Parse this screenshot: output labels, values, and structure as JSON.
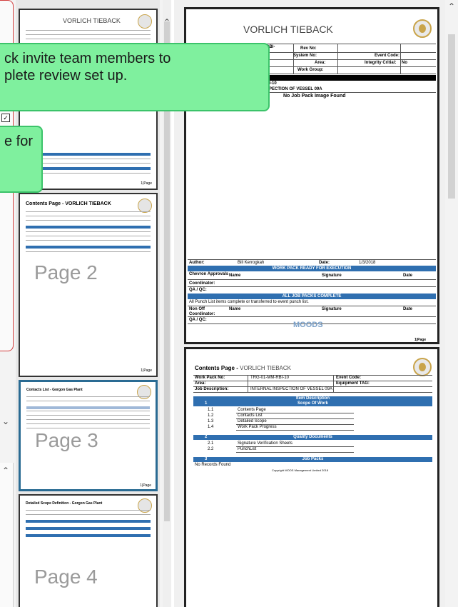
{
  "sidebar": {
    "scroll_up_icon": "chevron-up-icon",
    "scroll_down_icon": "chevron-down-icon"
  },
  "thumbnails": [
    {
      "id": "page-1",
      "title": "VORLICH TIEBACK",
      "label": ""
    },
    {
      "id": "page-2",
      "title": "Contents Page - VORLICH TIEBACK",
      "label": "Page 2"
    },
    {
      "id": "page-3",
      "title": "Contacts List - Gorgon Gas Plant",
      "label": "Page 3"
    },
    {
      "id": "page-4",
      "title": "Detailed Scope Definition - Gorgon Gas Plant",
      "label": "Page 4"
    }
  ],
  "tooltips": {
    "invite": "ck invite team members to\nplete review set up.",
    "second": "e for\n"
  },
  "page1": {
    "title": "VORLICH TIEBACK",
    "work_pack_no_label": "Work Pack No:",
    "work_pack_no_value": "RBI-",
    "rev_no_label": "Rev No:",
    "system_no_label": "System No:",
    "event_code_label": "Event Code:",
    "area_label": "Area:",
    "integrity_critical_label": "Integrity Critial:",
    "integrity_critical_value": "No",
    "work_group_label": "Work Group:",
    "code_line": "BI-10",
    "description_line": "SPECTION OF VESSEL 09A",
    "no_image": "No Job Pack Image Found",
    "author_label": "Author:",
    "author_value": "Bill Kerrogkah",
    "date_label": "Date:",
    "date_value": "1/3/2018",
    "ready_bar": "WORK PACK READY FOR EXECUTION",
    "chevron_label": "Chevron Approvals",
    "name_label": "Name",
    "signature_label": "Signature",
    "date_col_label": "Date",
    "coordinator_label": "Coordinator:",
    "qaqc_label": "QA / QC:",
    "complete_bar": "ALL JOB PACKS COMPLETE",
    "punch_note": "All Punch List items complete or transferred to event punch list.",
    "non_off_label": "Non Off",
    "name2_label": "Name",
    "signature2_label": "Signature",
    "date2_label": "Date",
    "coordinator2_label": "Coordinator:",
    "qaqc2_label": "QA / QC:",
    "moods": "MOODS",
    "page_footer": "1|Page"
  },
  "page2": {
    "title_bold": "Contents Page - ",
    "title_brand": "VORLICH TIEBACK",
    "work_pack_no_label": "Work Pack No:",
    "work_pack_no_value": "TRG-01-MM-RBI-10",
    "event_code_label": "Event Code:",
    "area_label": "Area:",
    "equipment_tag_label": "Equipment TAG:",
    "job_description_label": "Job Description:",
    "job_description_value": "INTERNAL INSPECTION OF VESSEL 09A",
    "item_description": "Item Description",
    "section1_num": "1",
    "section1_title": "Scope Of Work",
    "section1_items": [
      {
        "num": "1.1",
        "label": "Contents Page"
      },
      {
        "num": "1.2",
        "label": "Contacts List"
      },
      {
        "num": "1.3",
        "label": "Detailed Scope"
      },
      {
        "num": "1.4",
        "label": "Work Pack Progress"
      }
    ],
    "section2_num": "2",
    "section2_title": "Quality Documents",
    "section2_items": [
      {
        "num": "2.1",
        "label": "Signature Verification Sheets"
      },
      {
        "num": "2.2",
        "label": "PunchList"
      }
    ],
    "section3_num": "3",
    "section3_title": "Job Packs",
    "no_records": "No Records Found",
    "copyright": "Copyright MOOS Management Limited 2018"
  }
}
